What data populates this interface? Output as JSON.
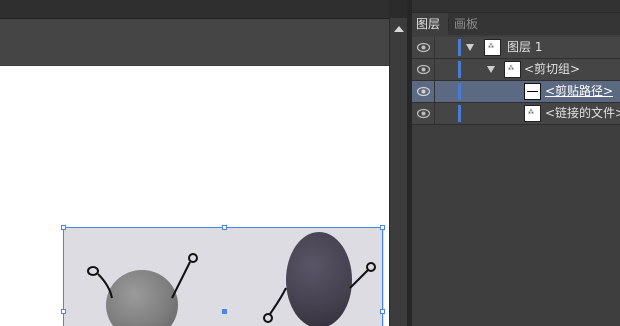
{
  "layers_panel": {
    "tabs": [
      {
        "label": "图层",
        "active": true
      },
      {
        "label": "画板",
        "active": false
      }
    ],
    "rows": [
      {
        "name": "图层 1",
        "expanded": true,
        "visible": true
      },
      {
        "name": "<剪切组>",
        "expanded": true,
        "visible": true
      },
      {
        "name": "<剪贴路径>",
        "selected": true,
        "visible": true
      },
      {
        "name": "<链接的文件>",
        "visible": true
      }
    ]
  },
  "colors": {
    "panel_bg": "#3e3e3e",
    "selection_row": "#5b6a82",
    "layer_color_bar": "#4a7bd3",
    "selection_box": "#4a86e8",
    "artboard": "#ffffff"
  },
  "icons": [
    "eye-icon",
    "expand-triangle-icon",
    "layer-thumbnail",
    "scroll-up-arrow-icon"
  ]
}
